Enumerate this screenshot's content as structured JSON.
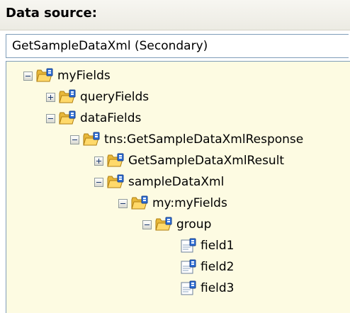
{
  "header": {
    "title": "Data source:"
  },
  "source": {
    "value": "GetSampleDataXml (Secondary)"
  },
  "tree": {
    "nodes": [
      {
        "label": "myFields",
        "state": "collapse",
        "icon": "folder-icon"
      },
      {
        "label": "queryFields",
        "state": "expand",
        "icon": "folder-icon"
      },
      {
        "label": "dataFields",
        "state": "collapse",
        "icon": "folder-icon"
      },
      {
        "label": "tns:GetSampleDataXmlResponse",
        "state": "collapse",
        "icon": "folder-icon"
      },
      {
        "label": "GetSampleDataXmlResult",
        "state": "expand",
        "icon": "folder-icon"
      },
      {
        "label": "sampleDataXml",
        "state": "collapse",
        "icon": "folder-icon"
      },
      {
        "label": "my:myFields",
        "state": "collapse",
        "icon": "folder-icon"
      },
      {
        "label": "group",
        "state": "collapse",
        "icon": "folder-icon"
      },
      {
        "label": "field1",
        "state": "none",
        "icon": "field-icon"
      },
      {
        "label": "field2",
        "state": "none",
        "icon": "field-icon"
      },
      {
        "label": "field3",
        "state": "none",
        "icon": "field-icon"
      }
    ]
  },
  "colors": {
    "tree_background": "#fdfbe2",
    "header_background": "#ecebe3",
    "border": "#7f9db9"
  }
}
